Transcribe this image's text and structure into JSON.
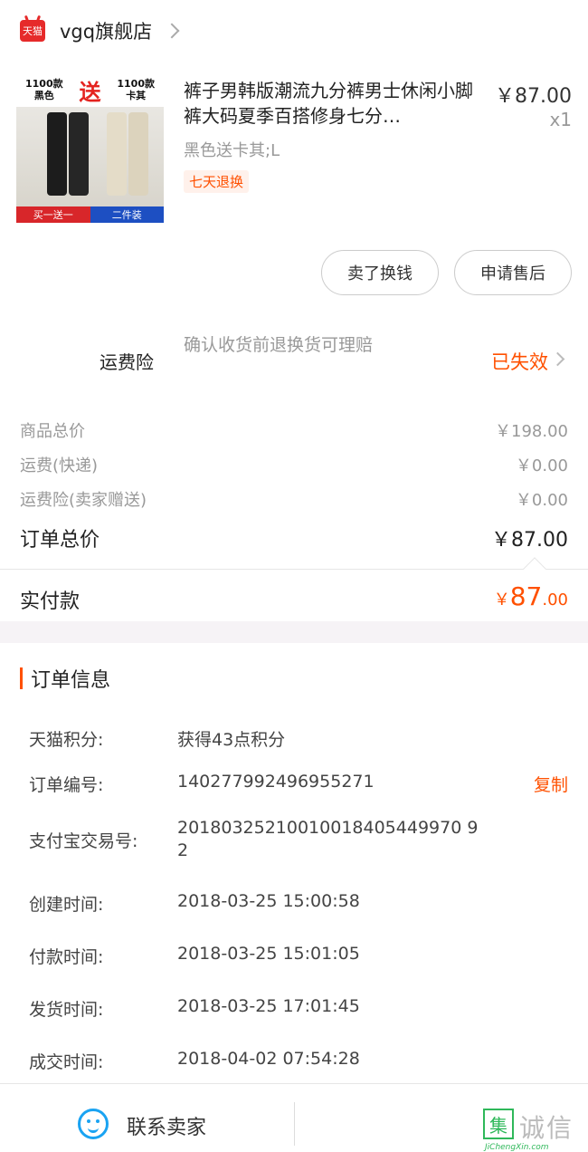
{
  "store": {
    "badge": "天猫",
    "name": "vgq旗舰店"
  },
  "product": {
    "image_banner": {
      "left_top": "1100款",
      "left_bottom": "黑色",
      "middle": "送",
      "right_top": "1100款",
      "right_bottom": "卡其",
      "footer_left": "买一送一",
      "footer_right": "二件装"
    },
    "title": "裤子男韩版潮流九分裤男士休闲小脚裤大码夏季百搭修身七分…",
    "sku": "黑色送卡其;L",
    "tag": "七天退换",
    "price": "￥87.00",
    "quantity": "x1"
  },
  "actions": {
    "sell": "卖了换钱",
    "after_sale": "申请售后"
  },
  "insurance": {
    "label": "运费险",
    "desc": "确认收货前退换货可理赔",
    "status": "已失效"
  },
  "summary": [
    {
      "label": "商品总价",
      "value": "￥198.00"
    },
    {
      "label": "运费(快递)",
      "value": "￥0.00"
    },
    {
      "label": "运费险(卖家赠送)",
      "value": "￥0.00"
    }
  ],
  "order_total": {
    "label": "订单总价",
    "value": "￥87.00"
  },
  "paid": {
    "label": "实付款",
    "currency": "￥",
    "integer": "87",
    "decimal": ".00"
  },
  "order_info": {
    "title": "订单信息",
    "rows": [
      {
        "label": "天猫积分:",
        "value": "获得43点积分"
      },
      {
        "label": "订单编号:",
        "value": "140277992496955271",
        "action": "复制"
      },
      {
        "label": "支付宝交易号:",
        "value": "20180325210010018405449970 9\n2"
      },
      {
        "label": "创建时间:",
        "value": "2018-03-25 15:00:58"
      },
      {
        "label": "付款时间:",
        "value": "2018-03-25 15:01:05"
      },
      {
        "label": "发货时间:",
        "value": "2018-03-25 17:01:45"
      },
      {
        "label": "成交时间:",
        "value": "2018-04-02 07:54:28"
      }
    ]
  },
  "footer": {
    "contact": "联系卖家"
  },
  "watermark": {
    "box": "集",
    "text": "诚信",
    "url": "JiChengXin.com"
  },
  "colors": {
    "accent": "#ff5000",
    "tmall_red": "#e62a2a",
    "chat_blue": "#1aa3f2"
  }
}
